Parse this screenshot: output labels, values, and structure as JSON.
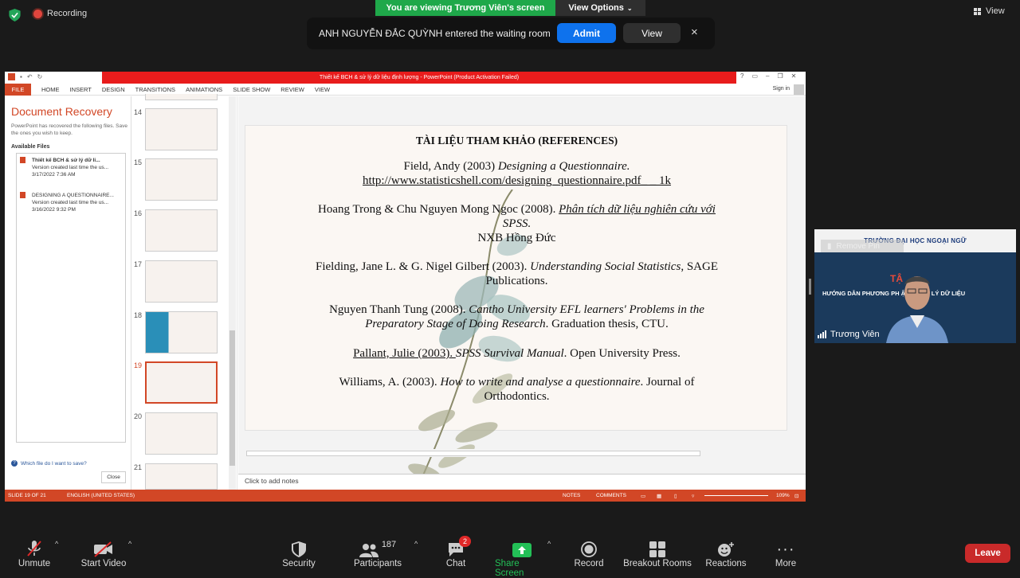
{
  "top": {
    "recording": "Recording",
    "viewing_banner": "You are viewing Trương Viên's screen",
    "view_options": "View Options",
    "view": "View"
  },
  "notification": {
    "message": "ANH NGUYỄN ĐẮC QUỲNH entered the waiting room",
    "admit": "Admit",
    "view": "View",
    "close": "×"
  },
  "ppt": {
    "title": "Thiết kế BCH & sử lý dữ liệu định lượng - PowerPoint (Product Activation Failed)",
    "tabs": [
      "FILE",
      "HOME",
      "INSERT",
      "DESIGN",
      "TRANSITIONS",
      "ANIMATIONS",
      "SLIDE SHOW",
      "REVIEW",
      "VIEW"
    ],
    "sign_in": "Sign in",
    "recovery": {
      "title": "Document Recovery",
      "desc": "PowerPoint has recovered the following files. Save the ones you wish to keep.",
      "available": "Available Files",
      "files": [
        {
          "name": "Thiết kế BCH & sử lý dữ li...",
          "line2": "Version created last time the us...",
          "line3": "3/17/2022 7:36 AM"
        },
        {
          "name": "DESIGNING A QUESTIONNAIRE...",
          "line2": "Version created last time the us...",
          "line3": "3/16/2022 9:32 PM"
        }
      ],
      "help": "Which file do I want to save?",
      "close": "Close"
    },
    "thumb_numbers": [
      "14",
      "15",
      "16",
      "17",
      "18",
      "19",
      "20",
      "21"
    ],
    "slide": {
      "title": "TÀI LIỆU THAM KHẢO (REFERENCES)",
      "refs": {
        "r1a": "Field, Andy  (2003) ",
        "r1b": "Designing a Questionnaire.",
        "r1c": "http://www.statisticshell.com/designing_questionnaire.pdf_ _ 1k",
        "r2a": "Hoang Trong & Chu Nguyen Mong Ngoc (2008). ",
        "r2b": "Phân tích dữ liệu nghiên cứu với",
        "r2c": "SPSS.",
        "r2d": "NXB Hồng Đức",
        "r3a": "Fielding, Jane L.  & G. Nigel Gilbert (2003). ",
        "r3b": "Understanding Social Statistics",
        "r3c": ", SAGE",
        "r3d": "Publications.",
        "r4a": "Nguyen Thanh Tung (2008). ",
        "r4b": "Cantho University EFL learners' Problems in the",
        "r4c": "Preparatory Stage of Doing Research",
        "r4d": ". Graduation thesis, CTU.",
        "r5a": "Pallant, Julie (2003). ",
        "r5b": "SPSS Survival Manual",
        "r5c": ". Open University Press.",
        "r6a": "Williams, A. (2003). ",
        "r6b": "How to write and analyse a questionnaire",
        "r6c": ". Journal of",
        "r6d": "Orthodontics."
      }
    },
    "notes": "Click to add notes",
    "status": {
      "slide": "SLIDE 19 OF 21",
      "lang": "ENGLISH (UNITED STATES)",
      "notes": "NOTES",
      "comments": "COMMENTS",
      "zoom": "109%"
    }
  },
  "video": {
    "banner": "TRƯỜNG ĐẠI HỌC NGOẠI NGỮ",
    "remove_pin": "Remove Pin",
    "slide_text1": "TẬ",
    "slide_text2": "HƯỚNG DẪN PHƯƠNG PH          ẬP VÀ XỬ LÝ DỮ LIỆU",
    "name": "Trương Viên"
  },
  "toolbar": {
    "unmute": "Unmute",
    "start_video": "Start Video",
    "security": "Security",
    "participants": "Participants",
    "participants_count": "187",
    "chat": "Chat",
    "chat_badge": "2",
    "share_screen": "Share Screen",
    "record": "Record",
    "breakout": "Breakout Rooms",
    "reactions": "Reactions",
    "more": "More",
    "leave": "Leave"
  },
  "colors": {
    "ppt_accent": "#d24726",
    "zoom_green": "#1fa84a",
    "zoom_blue": "#0e72ed",
    "leave_red": "#c92a2a"
  }
}
